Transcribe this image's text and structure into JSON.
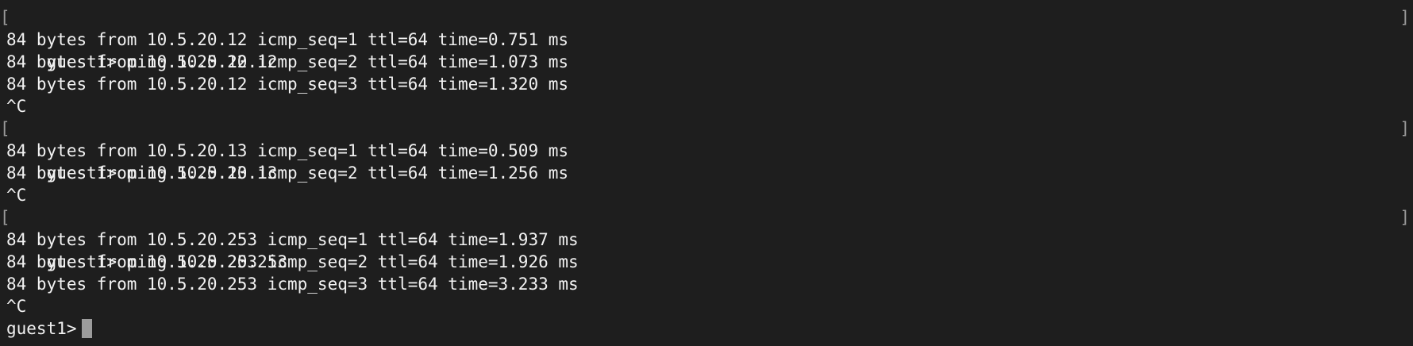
{
  "terminal": {
    "bracket_open": "[",
    "bracket_close": "]",
    "lines": [
      {
        "type": "prompt",
        "text": "guest1> ping 10.5.20.12"
      },
      {
        "type": "output",
        "text": "84 bytes from 10.5.20.12 icmp_seq=1 ttl=64 time=0.751 ms"
      },
      {
        "type": "output",
        "text": "84 bytes from 10.5.20.12 icmp_seq=2 ttl=64 time=1.073 ms"
      },
      {
        "type": "output",
        "text": "84 bytes from 10.5.20.12 icmp_seq=3 ttl=64 time=1.320 ms"
      },
      {
        "type": "output",
        "text": "^C"
      },
      {
        "type": "prompt",
        "text": "guest1> ping 10.5.20.13"
      },
      {
        "type": "output",
        "text": "84 bytes from 10.5.20.13 icmp_seq=1 ttl=64 time=0.509 ms"
      },
      {
        "type": "output",
        "text": "84 bytes from 10.5.20.13 icmp_seq=2 ttl=64 time=1.256 ms"
      },
      {
        "type": "output",
        "text": "^C"
      },
      {
        "type": "prompt",
        "text": "guest1> ping 10.5.20.253"
      },
      {
        "type": "output",
        "text": "84 bytes from 10.5.20.253 icmp_seq=1 ttl=64 time=1.937 ms"
      },
      {
        "type": "output",
        "text": "84 bytes from 10.5.20.253 icmp_seq=2 ttl=64 time=1.926 ms"
      },
      {
        "type": "output",
        "text": "84 bytes from 10.5.20.253 icmp_seq=3 ttl=64 time=3.233 ms"
      },
      {
        "type": "output",
        "text": "^C"
      }
    ],
    "current_prompt": "guest1>"
  },
  "colors": {
    "background": "#1e1e1e",
    "foreground": "#f2f2f2",
    "cursor": "#9c9c9c",
    "bracket": "#9a9a9a"
  }
}
